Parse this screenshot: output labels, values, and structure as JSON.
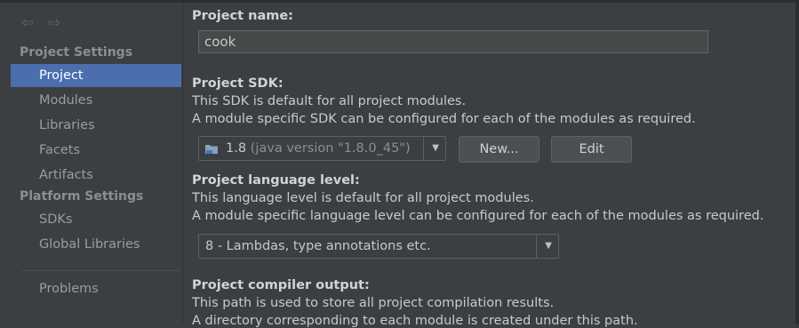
{
  "sidebar": {
    "project_settings_header": "Project Settings",
    "project_settings_items": [
      {
        "label": "Project",
        "selected": true
      },
      {
        "label": "Modules"
      },
      {
        "label": "Libraries"
      },
      {
        "label": "Facets"
      },
      {
        "label": "Artifacts"
      }
    ],
    "platform_settings_header": "Platform Settings",
    "platform_settings_items": [
      {
        "label": "SDKs"
      },
      {
        "label": "Global Libraries"
      }
    ],
    "problems_label": "Problems"
  },
  "project": {
    "name_label": "Project name:",
    "name_value": "cook",
    "sdk_label": "Project SDK:",
    "sdk_desc1": "This SDK is default for all project modules.",
    "sdk_desc2": "A module specific SDK can be configured for each of the modules as required.",
    "sdk_selected_version": "1.8",
    "sdk_selected_detail": "(java version \"1.8.0_45\")",
    "new_button": "New...",
    "edit_button": "Edit",
    "lang_label": "Project language level:",
    "lang_desc1": "This language level is default for all project modules.",
    "lang_desc2": "A module specific language level can be configured for each of the modules as required.",
    "lang_selected": "8 - Lambdas, type annotations etc.",
    "compiler_label": "Project compiler output:",
    "compiler_desc1": "This path is used to store all project compilation results.",
    "compiler_desc2": "A directory corresponding to each module is created under this path."
  },
  "colors": {
    "selection": "#4b6eaf",
    "background": "#3c3f41"
  }
}
